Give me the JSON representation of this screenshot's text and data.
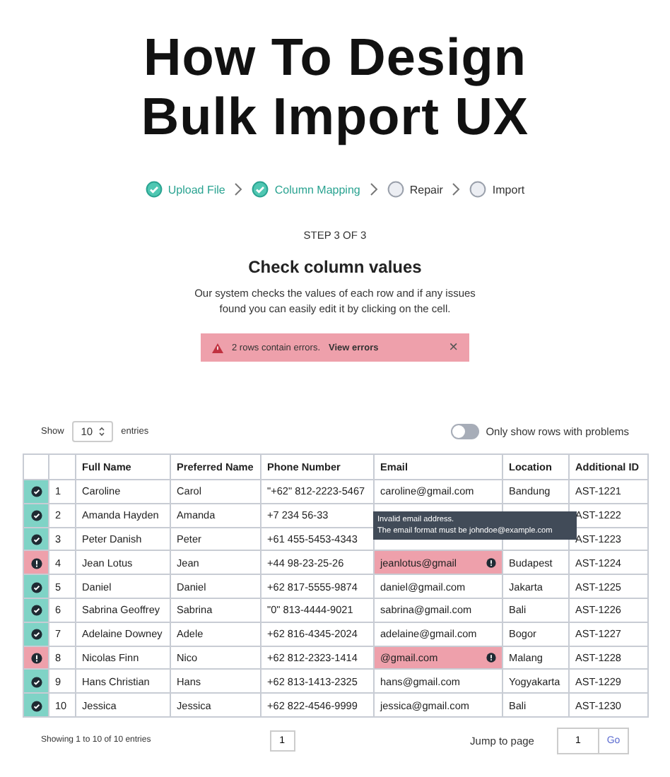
{
  "headline": {
    "lines": [
      "How To Design",
      "Bulk Import UX"
    ]
  },
  "steps": [
    {
      "label": "Upload File",
      "done": true
    },
    {
      "label": "Column Mapping",
      "done": true
    },
    {
      "label": "Repair",
      "done": false
    },
    {
      "label": "Import",
      "done": false
    }
  ],
  "step_counter": "STEP 3 OF 3",
  "heading": "Check column values",
  "description": "Our system checks the values of each row and if any issues found you can easily edit it by clicking on the cell.",
  "alert": {
    "message": "2 rows contain errors.",
    "link": "View errors",
    "close": "×"
  },
  "entries": {
    "show": "Show",
    "value": "10",
    "suffix": "entries"
  },
  "filter_toggle": {
    "label": "Only show rows with problems",
    "on": false
  },
  "table": {
    "columns": [
      "Full Name",
      "Preferred Name",
      "Phone Number",
      "Email",
      "Location",
      "Additional ID"
    ],
    "rows": [
      {
        "valid": true,
        "number": "1",
        "cells": [
          "Caroline",
          "Carol",
          "\"+62\" 812-2223-5467",
          "caroline@gmail.com",
          "Bandung",
          "AST-1221"
        ],
        "email_error": false
      },
      {
        "valid": true,
        "number": "2",
        "cells": [
          "Amanda Hayden",
          "Amanda",
          "+7 234 56-33",
          null,
          null,
          "AST-1222"
        ],
        "email_error": false
      },
      {
        "valid": true,
        "number": "3",
        "cells": [
          "Peter Danish",
          "Peter",
          "+61 455-5453-4343",
          null,
          null,
          "AST-1223"
        ],
        "email_error": false
      },
      {
        "valid": false,
        "number": "4",
        "cells": [
          "Jean Lotus",
          "Jean",
          "+44 98-23-25-26",
          "jeanlotus@gmail",
          "Budapest",
          "AST-1224"
        ],
        "email_error": true
      },
      {
        "valid": true,
        "number": "5",
        "cells": [
          "Daniel",
          "Daniel",
          "+62 817-5555-9874",
          "daniel@gmail.com",
          "Jakarta",
          "AST-1225"
        ],
        "email_error": false
      },
      {
        "valid": true,
        "number": "6",
        "cells": [
          "Sabrina Geoffrey",
          "Sabrina",
          "\"0\" 813-4444-9021",
          "sabrina@gmail.com",
          "Bali",
          "AST-1226"
        ],
        "email_error": false
      },
      {
        "valid": true,
        "number": "7",
        "cells": [
          "Adelaine Downey",
          "Adele",
          "+62 816-4345-2024",
          "adelaine@gmail.com",
          "Bogor",
          "AST-1227"
        ],
        "email_error": false
      },
      {
        "valid": false,
        "number": "8",
        "cells": [
          "Nicolas Finn",
          "Nico",
          "+62 812-2323-1414",
          "@gmail.com",
          "Malang",
          "AST-1228"
        ],
        "email_error": true
      },
      {
        "valid": true,
        "number": "9",
        "cells": [
          "Hans Christian",
          "Hans",
          "+62 813-1413-2325",
          "hans@gmail.com",
          "Yogyakarta",
          "AST-1229"
        ],
        "email_error": false
      },
      {
        "valid": true,
        "number": "10",
        "cells": [
          "Jessica",
          "Jessica",
          "+62 822-4546-9999",
          "jessica@gmail.com",
          "Bali",
          "AST-1230"
        ],
        "email_error": false
      }
    ]
  },
  "tooltip": {
    "lines": [
      "Invalid email address.",
      "The email format must be johndoe@example.com"
    ]
  },
  "footer": {
    "summary": "Showing 1 to 10 of 10 entries",
    "page": "1",
    "jump_label": "Jump to page",
    "jump_value": "1",
    "go": "Go"
  }
}
